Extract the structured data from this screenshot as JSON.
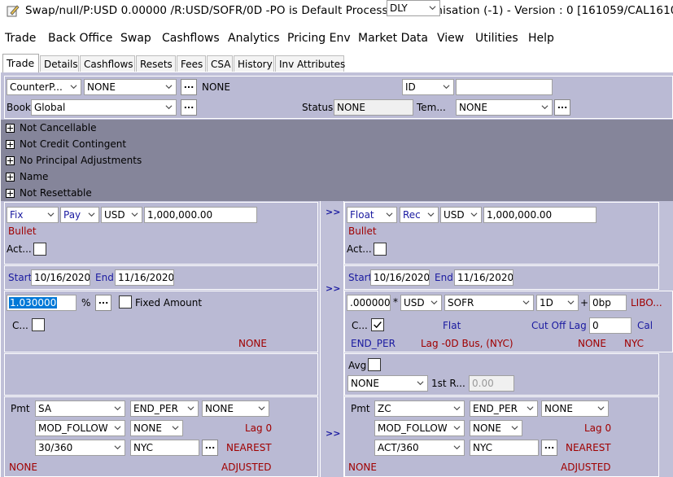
{
  "title": "Swap/null/P:USD 0.00000 /R:USD/SOFR/0D  -PO is Default Processing Organisation  (-1) - Version : 0  [161059/CAL1610]",
  "menu": [
    "Trade",
    "Back Office",
    "Swap",
    "Cashflows",
    "Analytics",
    "Pricing Env",
    "Market Data",
    "View",
    "Utilities",
    "Help"
  ],
  "tabs": [
    "Trade",
    "Details",
    "Cashflows",
    "Resets",
    "Fees",
    "CSA",
    "History",
    "Inv Attributes"
  ],
  "header": {
    "counterparty_select": "CounterP...",
    "counterparty_value": "NONE",
    "counterparty_name": "NONE",
    "id_select": "ID",
    "id_value": "",
    "book_label": "Book",
    "book_value": "Global",
    "status_label": "Status",
    "status_value": "NONE",
    "template_label": "Tem...",
    "template_value": "NONE",
    "ellipsis": "..."
  },
  "expanders": [
    "Not Cancellable",
    "Not Credit Contingent",
    "No Principal Adjustments",
    "Name",
    "Not Resettable"
  ],
  "pay_leg": {
    "type": "Fix",
    "direction": "Pay",
    "currency": "USD",
    "notional": "1,000,000.00",
    "amort": "Bullet",
    "act_label": "Act...",
    "start_label": "Start",
    "start": "10/16/2020",
    "end_label": "End",
    "end": "11/16/2020",
    "rate": "1.030000",
    "pct": "%",
    "fixed_amount": "Fixed Amount",
    "c_label": "C...",
    "none1": "NONE",
    "pmt_label": "Pmt",
    "freq": "SA",
    "roll": "END_PER",
    "roll2": "NONE",
    "bdc": "MOD_FOLLOW",
    "bdc2": "NONE",
    "lag": "Lag 0",
    "daycount": "30/360",
    "holiday": "NYC",
    "nearest": "NEAREST",
    "none_bottom": "NONE",
    "adjusted": "ADJUSTED"
  },
  "rec_leg": {
    "type": "Float",
    "direction": "Rec",
    "currency": "USD",
    "notional": "1,000,000.00",
    "amort": "Bullet",
    "act_label": "Act...",
    "start_label": "Start",
    "start": "10/16/2020",
    "end_label": "End",
    "end": "11/16/2020",
    "factor": ".000000",
    "star": "*",
    "rate_ccy": "USD",
    "index": "SOFR",
    "tenor": "1D",
    "plus": "+",
    "spread": "0bp",
    "libor": "LIBO...",
    "c_label": "C...",
    "compound": "DLY",
    "flat": "Flat",
    "cutoff_label": "Cut Off Lag",
    "cutoff": "0",
    "cal": "Cal",
    "end_per": "END_PER",
    "lag_desc": "Lag -0D Bus, (NYC)",
    "none_a": "NONE",
    "nyc": "NYC",
    "avg_label": "Avg",
    "avg_value": "NONE",
    "first_rate_label": "1st R...",
    "first_rate": "0.00",
    "pmt_label": "Pmt",
    "freq": "ZC",
    "roll": "END_PER",
    "roll2": "NONE",
    "bdc": "MOD_FOLLOW",
    "bdc2": "NONE",
    "lag": "Lag 0",
    "daycount": "ACT/360",
    "holiday": "NYC",
    "nearest": "NEAREST",
    "none_bottom": "NONE",
    "adjusted": "ADJUSTED"
  },
  "arrows": ">>"
}
